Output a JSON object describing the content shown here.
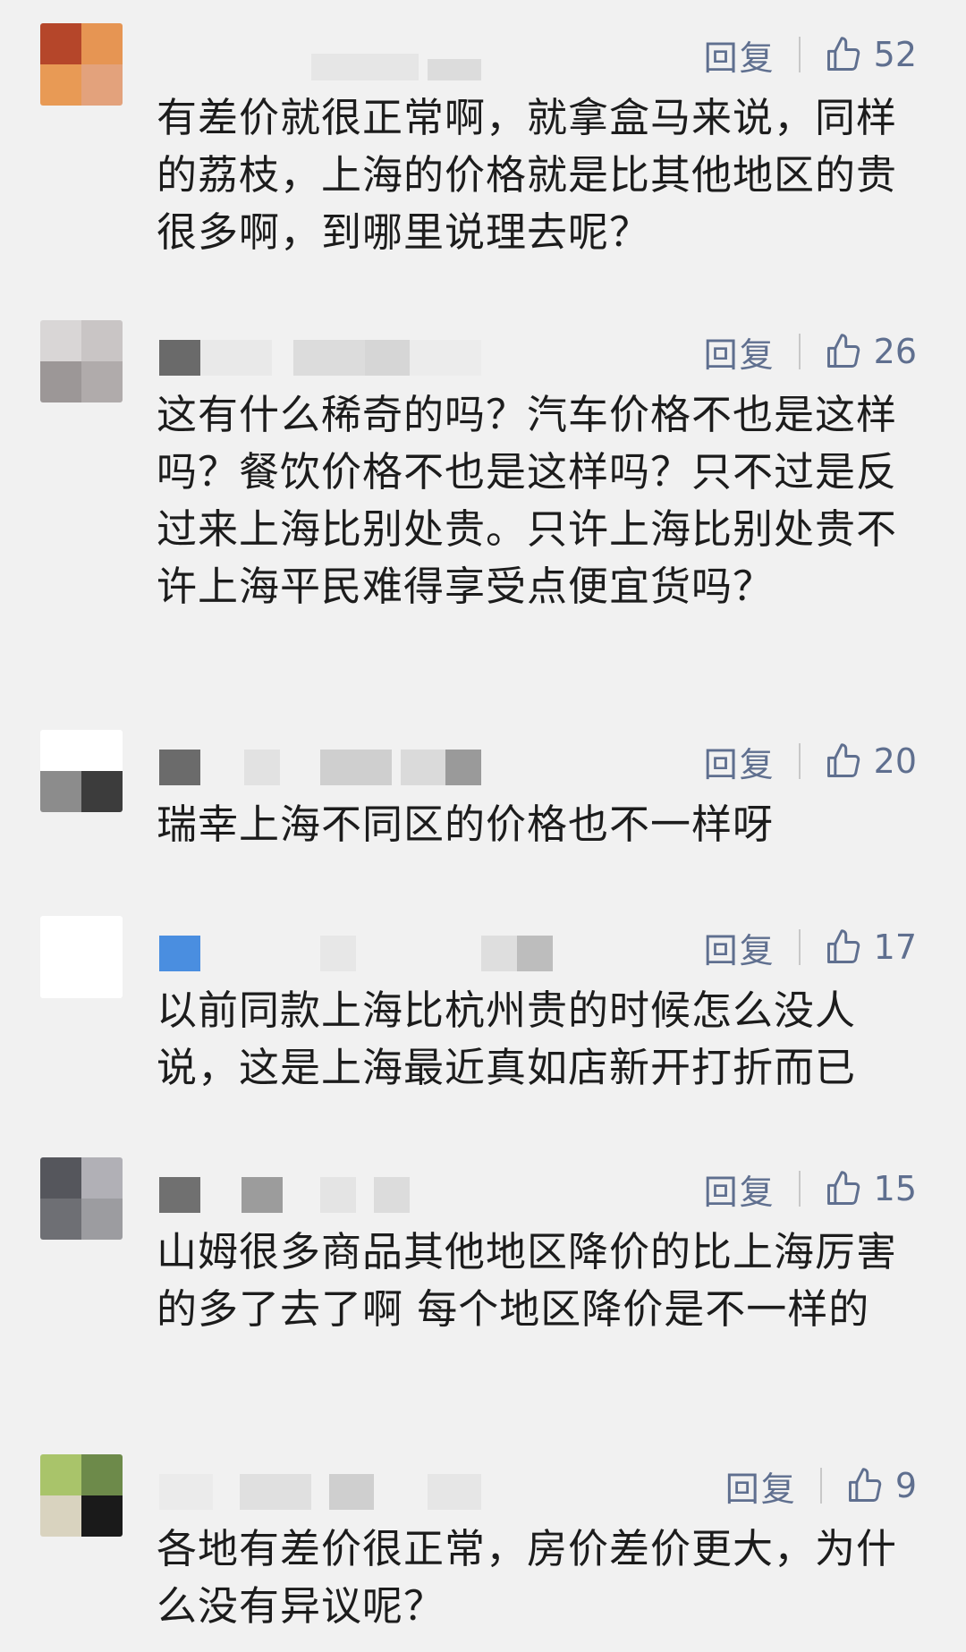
{
  "comments": [
    {
      "text": "有差价就很正常啊，就拿盒马来说，同样的荔枝，上海的价格就是比其他地区的贵很多啊，到哪里说理去呢？",
      "reply_label": "回复",
      "likes": "52",
      "avatar_colors": [
        "#b5462a",
        "#e69553",
        "#e89a55",
        "#e3a27c"
      ],
      "name_blocks": [
        "#dcdcdc",
        "#e4e4e4"
      ]
    },
    {
      "text": "这有什么稀奇的吗？汽车价格不也是这样吗？餐饮价格不也是这样吗？只不过是反过来上海比别处贵。只许上海比别处贵不许上海平民难得享受点便宜货吗？",
      "reply_label": "回复",
      "likes": "26",
      "avatar_colors": [
        "#d9d6d6",
        "#c9c5c5",
        "#9c9797",
        "#b0abab"
      ],
      "name_blocks": [
        "#6a6a6a",
        "#e9e9e9",
        "#dcdcdc",
        "#d6d6d6",
        "#e6e6e6"
      ]
    },
    {
      "text": "瑞幸上海不同区的价格也不一样呀",
      "reply_label": "回复",
      "likes": "20",
      "avatar_colors": [
        "#ffffff",
        "#ffffff",
        "#8c8c8c",
        "#3c3c3c"
      ],
      "name_blocks": [
        "#6b6b6b",
        "#e2e2e2",
        "#cfcfcf",
        "#dadada",
        "#9a9a9a"
      ]
    },
    {
      "text": "以前同款上海比杭州贵的时候怎么没人说，这是上海最近真如店新开打折而已",
      "reply_label": "回复",
      "likes": "17",
      "avatar_colors": [
        "#ffffff",
        "#ffffff",
        "#ffffff",
        "#ffffff"
      ],
      "name_blocks": [
        "#4a8ee0",
        "#e7e7e7",
        "#dedede",
        "#bdbdbd"
      ]
    },
    {
      "text": "山姆很多商品其他地区降价的比上海厉害的多了去了啊 每个地区降价是不一样的",
      "reply_label": "回复",
      "likes": "15",
      "avatar_colors": [
        "#55565c",
        "#b1b0b6",
        "#6e6f74",
        "#9c9ca0"
      ],
      "name_blocks": [
        "#707070",
        "#9c9c9c",
        "#e4e4e4",
        "#dcdcdc"
      ]
    },
    {
      "text": "各地有差价很正常，房价差价更大，为什么没有异议呢？",
      "reply_label": "回复",
      "likes": "9",
      "avatar_colors": [
        "#a9c46a",
        "#6d8a4a",
        "#d9d3bf",
        "#1a1a1a"
      ],
      "name_blocks": [
        "#e0e0e0",
        "#cfcfcf",
        "#e6e6e6",
        "#d4d4d4"
      ]
    }
  ],
  "colors": {
    "background": "#f1f1f1",
    "text": "#1c1c1c",
    "action": "#5f6f8f"
  }
}
